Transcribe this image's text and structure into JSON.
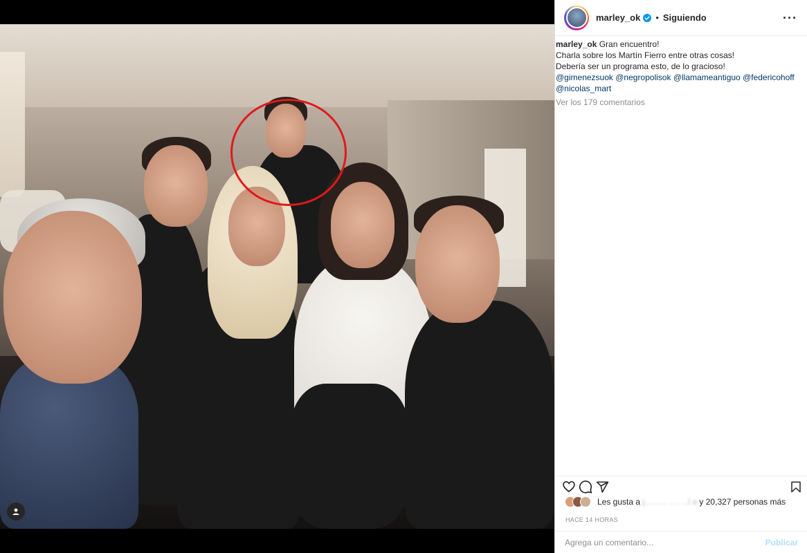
{
  "post": {
    "username": "marley_ok",
    "verified": true,
    "separator": "•",
    "follow_status": "Siguiendo",
    "more": "···"
  },
  "caption": {
    "username": "marley_ok",
    "line1": "Gran encuentro!",
    "line2": "Charla sobre los Martín Fierro entre otras cosas!",
    "line3": "Debería ser un programa esto, de lo gracioso!",
    "mentions": [
      "@gimenezsuok",
      "@negropolisok",
      "@llamameantiguo",
      "@federicohoff",
      "@nicolas_mart"
    ],
    "comments_link": "Ver los 179 comentarios"
  },
  "actions": {
    "like_icon": "heart-icon",
    "comment_icon": "comment-icon",
    "share_icon": "share-icon",
    "save_icon": "bookmark-icon"
  },
  "likes": {
    "prefix": "Les gusta a",
    "obscured": "j..........  ....  ...l a",
    "suffix": "y 20,327 personas más"
  },
  "time": "HACE 14 HORAS",
  "comment": {
    "placeholder": "Agrega un comentario...",
    "publish": "Publicar"
  },
  "colors": {
    "accent_link": "#00376b",
    "publish_disabled": "#b2dffc",
    "highlight_circle": "#e0191b",
    "verified": "#0095f6"
  }
}
